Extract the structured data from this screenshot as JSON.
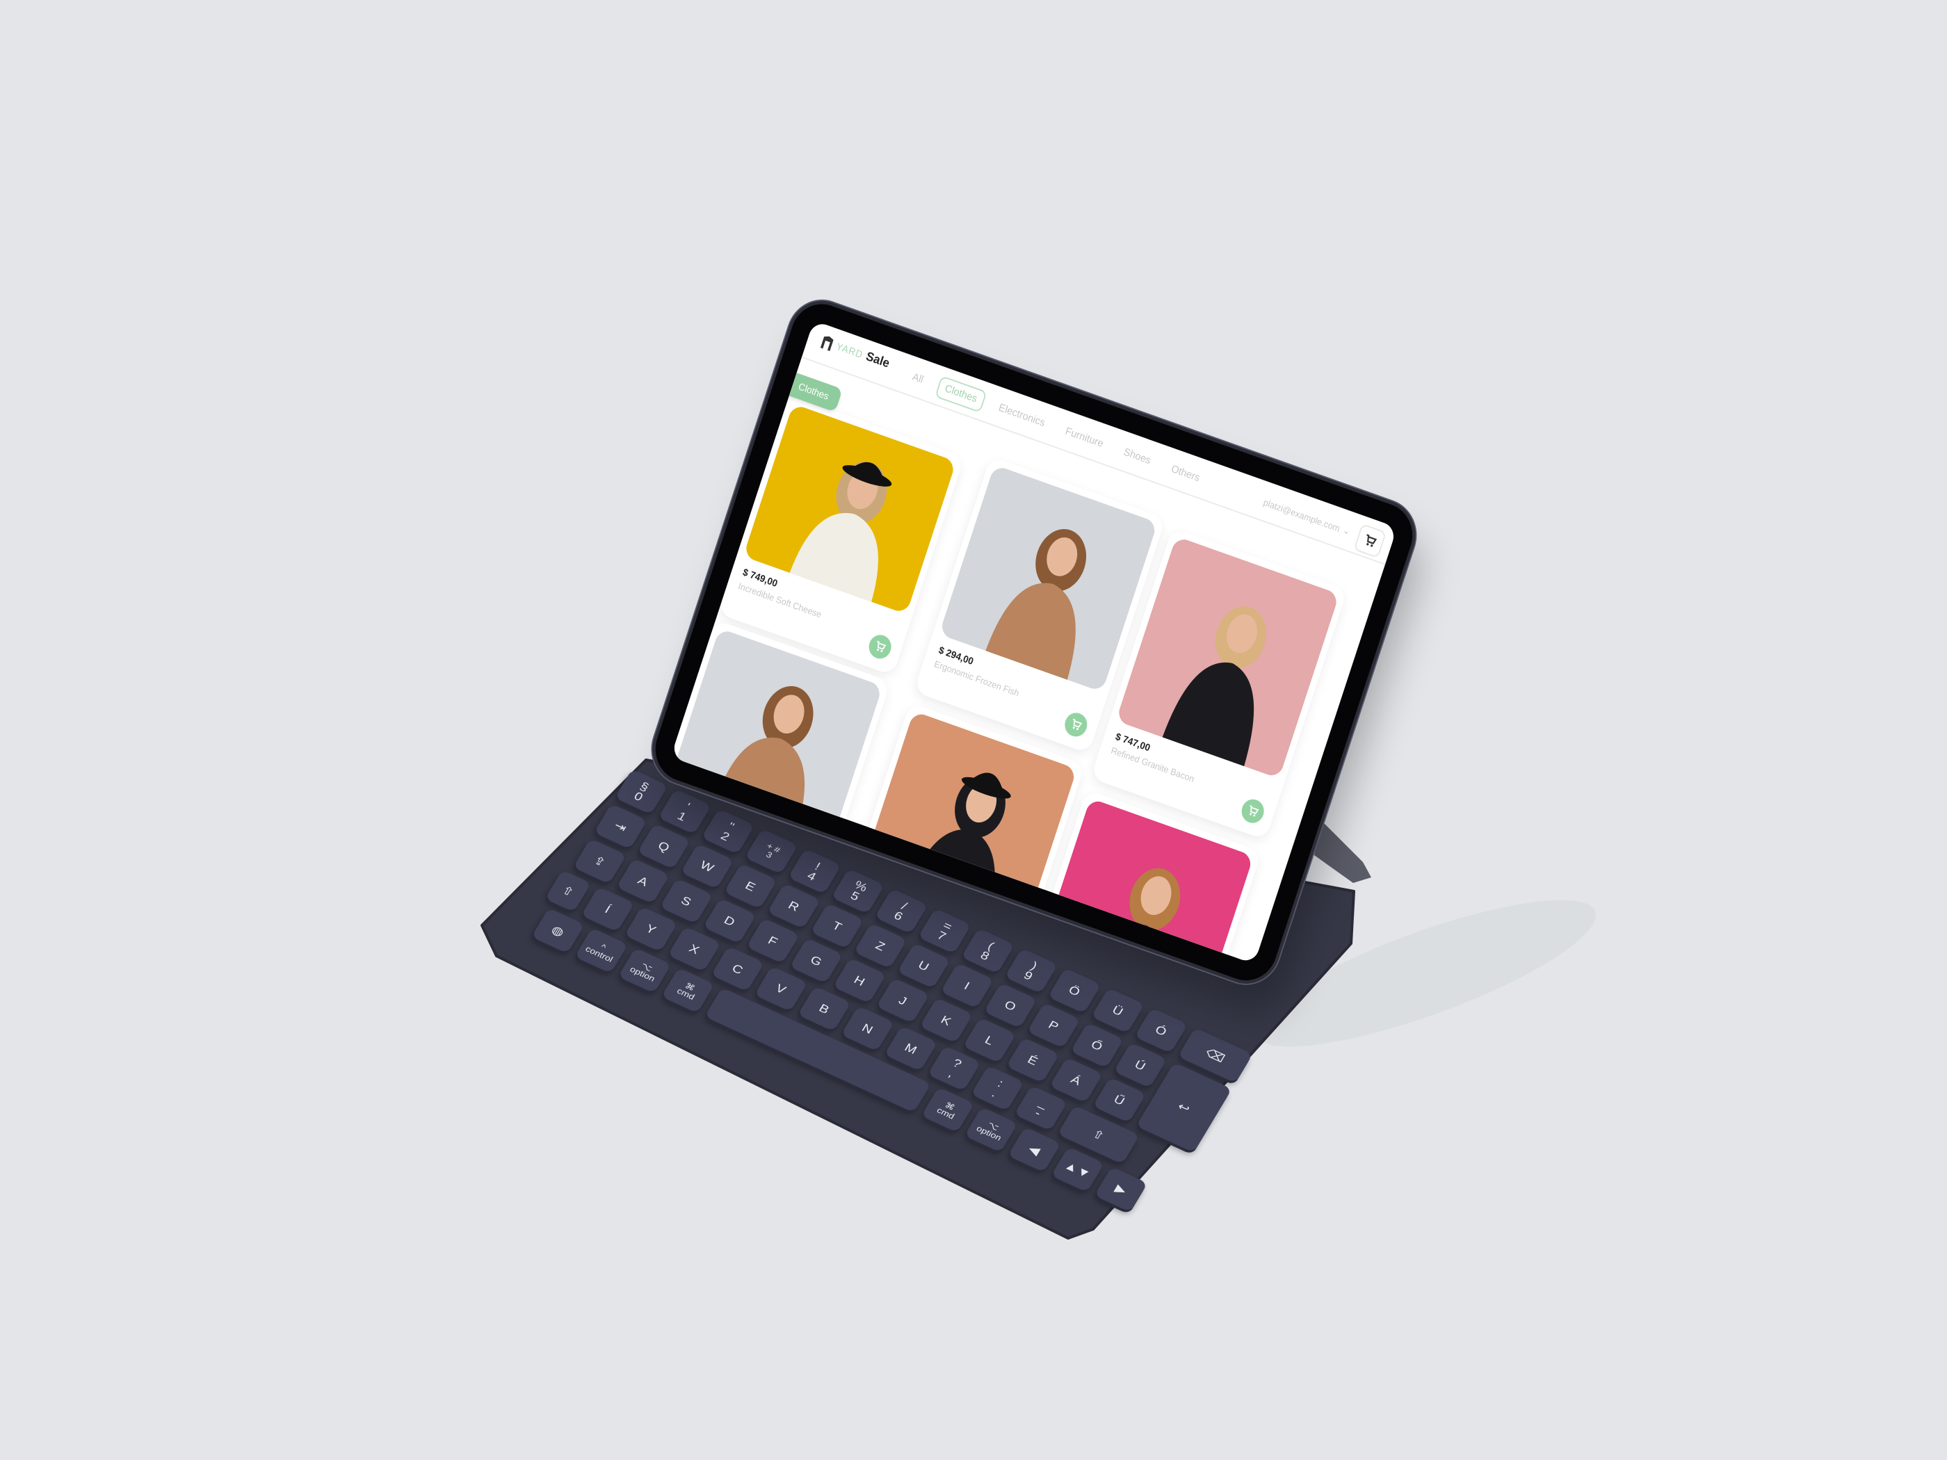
{
  "app": {
    "logo_part1": "YARD",
    "logo_part2": "Sale",
    "nav_tabs": [
      "All",
      "Clothes",
      "Electronics",
      "Furniture",
      "Shoes",
      "Others"
    ],
    "active_tab": "Clothes",
    "user_email": "platzi@example.com",
    "category_tag": "Clothes",
    "accent_color": "#93d3a2",
    "products": [
      {
        "price": "$ 749,00",
        "name": "Incredible Soft Cheese",
        "bg": "#e8b800",
        "shirt": "#f1eee6",
        "hair": "#c9a77a",
        "hat": true
      },
      {
        "price": "$ 294,00",
        "name": "Ergonomic Frozen Fish",
        "bg": "#d3d6da",
        "shirt": "#b9845e",
        "hair": "#8a5a36",
        "hat": false
      },
      {
        "price": "$ 747,00",
        "name": "Refined Granite Bacon",
        "bg": "#e4a9aa",
        "shirt": "#1b1b1f",
        "hair": "#d9b27f",
        "hat": false
      },
      {
        "bg": "#d5d8dc",
        "shirt": "#b9845e",
        "hair": "#8a5a36",
        "hat": false
      },
      {
        "bg": "#d8946f",
        "shirt": "#1b1b1f",
        "hair": "#1b1b1f",
        "hat": true
      },
      {
        "bg": "#e2407f",
        "shirt": "#2f4f8a",
        "hair": "#b77b44",
        "hat": false
      }
    ]
  },
  "keyboard": {
    "rows": [
      [
        "§\n0",
        "'\n1",
        "\"\n2",
        "+ #\n3",
        "!\n4",
        "%\n5",
        "/\n6",
        "=\n7",
        "(\n8",
        ")\n9",
        "Ö",
        "Ü",
        "Ó",
        "⌫"
      ],
      [
        "⇥",
        "Q",
        "W",
        "E",
        "R",
        "T",
        "Z",
        "U",
        "I",
        "O",
        "P",
        "Ő",
        "Ú",
        "↩"
      ],
      [
        "⇪",
        "A",
        "S",
        "D",
        "F",
        "G",
        "H",
        "J",
        "K",
        "L",
        "É",
        "Á",
        "Ű"
      ],
      [
        "⇧",
        "Í",
        "Y",
        "X",
        "C",
        "V",
        "B",
        "N",
        "M",
        "?\n,",
        ":\n.",
        "_\n-",
        "⇧"
      ],
      [
        "◍",
        "^\ncontrol",
        "⌥\noption",
        "⌘\ncmd",
        "",
        "⌘\ncmd",
        "⌥\noption",
        "◀",
        "▲▼",
        "▶"
      ]
    ]
  }
}
